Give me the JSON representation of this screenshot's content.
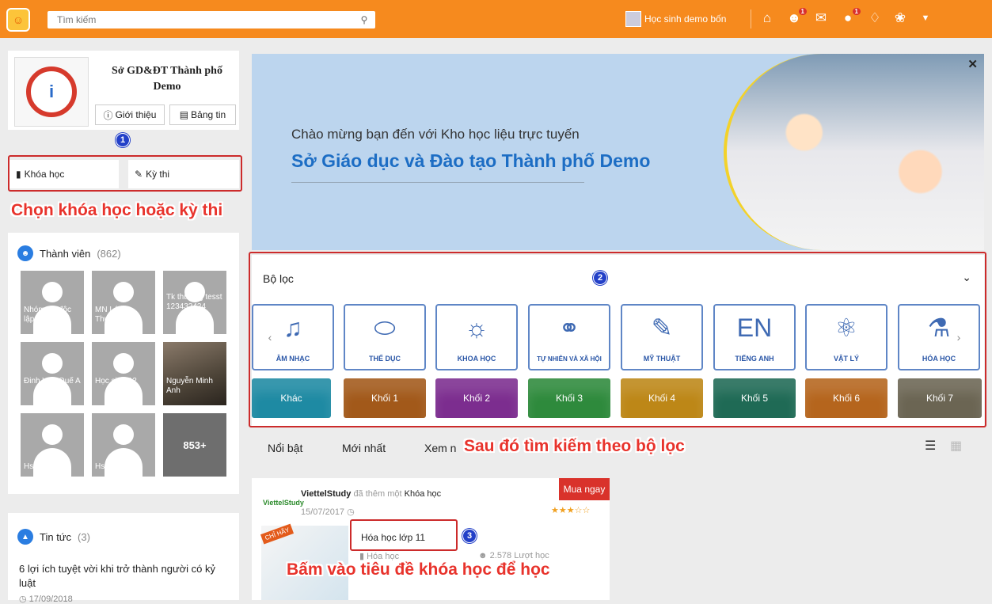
{
  "topbar": {
    "search_placeholder": "Tìm kiếm",
    "user_name": "Học sinh demo bốn",
    "badges": {
      "notif1": "1",
      "notif2": "1"
    },
    "color": "#f68a1e"
  },
  "org": {
    "name": "Sở GD&ĐT Thành phố Demo",
    "intro_label": "Giới thiệu",
    "news_label": "Bảng tin"
  },
  "tabs_left": {
    "courses_label": "Khóa học",
    "exams_label": "Kỳ thi"
  },
  "annotations": {
    "n1": "1",
    "n2": "2",
    "n3": "3",
    "callout1": "Chọn khóa học hoặc kỳ thi",
    "callout2": "Sau đó tìm kiếm theo bộ lọc",
    "callout3": "Bấm vào tiêu đề khóa học để học"
  },
  "members": {
    "title": "Thành viên",
    "count": "(862)",
    "items": [
      {
        "name": "Nhóm trẻ độc lập Cầu Giấy"
      },
      {
        "name": "MN Láng Thượng"
      },
      {
        "name": "Tk thường tesst 123432424"
      },
      {
        "name": "Đinh Văn Quế A"
      },
      {
        "name": "Học sinh 12"
      },
      {
        "name": "Nguyễn Minh Anh"
      },
      {
        "name": "Hs test"
      },
      {
        "name": "Hs Test"
      }
    ],
    "more": "853+"
  },
  "news": {
    "title": "Tin tức",
    "count": "(3)",
    "item_title": "6 lợi ích tuyệt vời khi trở thành người có kỷ luật",
    "item_date": "17/09/2018"
  },
  "banner": {
    "line1": "Chào mừng bạn đến với Kho học liệu trực tuyến",
    "line2": "Sở Giáo dục và Đào tạo Thành phố Demo"
  },
  "filter": {
    "title": "Bộ lọc",
    "subjects": [
      {
        "label": "ÂM NHẠC",
        "icon": "music-icon"
      },
      {
        "label": "THỂ DỤC",
        "icon": "football-icon"
      },
      {
        "label": "KHOA HỌC",
        "icon": "bulb-icon"
      },
      {
        "label": "TỰ NHIÊN VÀ XÃ HỘI",
        "icon": "planet-icon"
      },
      {
        "label": "MỸ THUẬT",
        "icon": "brush-icon"
      },
      {
        "label": "TIẾNG ANH",
        "icon": "en-icon"
      },
      {
        "label": "VẬT LÝ",
        "icon": "atom-icon"
      },
      {
        "label": "HÓA HỌC",
        "icon": "flask-icon"
      }
    ],
    "grades": [
      {
        "label": "Khác",
        "color": "#1e8aa3"
      },
      {
        "label": "Khối 1",
        "color": "#a2591a"
      },
      {
        "label": "Khối 2",
        "color": "#7c2d8f"
      },
      {
        "label": "Khối 3",
        "color": "#2e8a3c"
      },
      {
        "label": "Khối 4",
        "color": "#bd8717"
      },
      {
        "label": "Khối 5",
        "color": "#1f6a55"
      },
      {
        "label": "Khối 6",
        "color": "#b5651d"
      },
      {
        "label": "Khối 7",
        "color": "#6b6553"
      }
    ]
  },
  "list_tabs": {
    "featured": "Nổi bật",
    "newest": "Mới nhất",
    "most_viewed": "Xem n"
  },
  "course": {
    "brand": "ViettelStudy",
    "author": "ViettelStudy",
    "action": "đã thêm một",
    "type": "Khóa học",
    "date": "15/07/2017",
    "buy_label": "Mua ngay",
    "stars": "★★★☆☆",
    "title": "Hóa học lớp 11",
    "subject": "Hóa học",
    "views": "2.578 Lượt học",
    "thumb_tag": "CHỈ HÃY"
  }
}
